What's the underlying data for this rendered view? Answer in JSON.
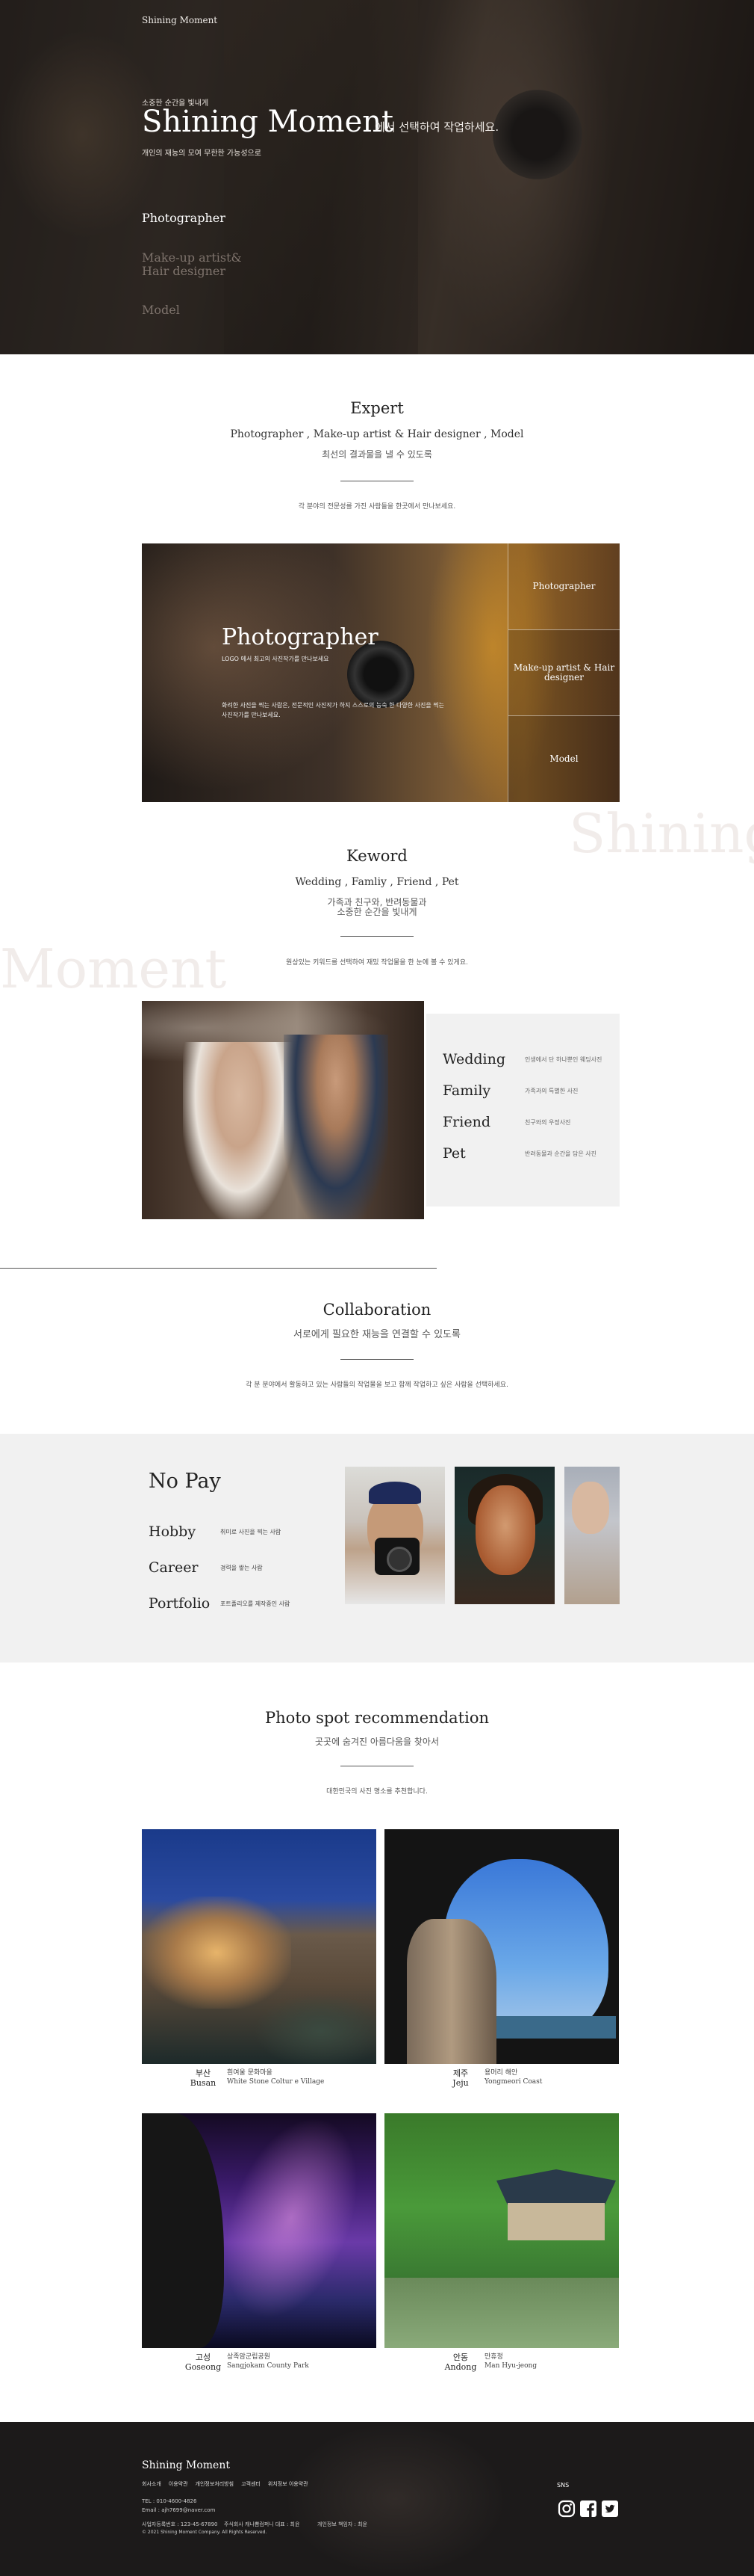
{
  "hero": {
    "brand": "Shining Moment",
    "small_caption": "소중한 순간을 빛내게",
    "title": "Shining Moment",
    "title_suffix": "에서 선택하여 작업하세요.",
    "subtitle": "개인의 재능의 모여 무한한 가능성으로",
    "menu": [
      "Photographer",
      "Make-up artist& Hair designer",
      "Model"
    ]
  },
  "expert": {
    "title": "Expert",
    "subtitle": "Photographer , Make-up artist & Hair designer , Model",
    "subtitle2": "최선의 결과물을 낼 수 있도록",
    "desc": "각 분야의 전문성를 가진 사람들을 한곳에서 만나보세요.",
    "panel_title": "Photographer",
    "panel_small": "LOGO 에서 최고의 사진작가를 만나보세요",
    "panel_desc": "화려한 사진을 찍는 사람은, 전문적인 사진작가 하지 스스로의 능숙 한 다양한 사진을 찍는 사진작가를 만나보세요.",
    "side_items": [
      "Photographer",
      "Make-up artist & Hair designer",
      "Model"
    ]
  },
  "watermarks": {
    "right": "Shining",
    "left": "Moment"
  },
  "keyword": {
    "title": "Keword",
    "subtitle": "Wedding , Famliy , Friend , Pet",
    "subtitle2_line1": "가족과 친구와, 반려동물과",
    "subtitle2_line2": "소중한 순간을 빛내게",
    "desc": "원상있는 키워드를 선택하여 재밌 작업물을 한 눈에 볼 수 있게요.",
    "items": [
      {
        "word": "Wedding",
        "desc": "인생에서 단 하나뿐인 웨딩사진"
      },
      {
        "word": "Family",
        "desc": "가족과의 특별한 사진"
      },
      {
        "word": "Friend",
        "desc": "친구와의 우정사진"
      },
      {
        "word": "Pet",
        "desc": "반려동물과 순간을 담은 사진"
      }
    ]
  },
  "collaboration": {
    "title": "Collaboration",
    "subtitle": "서로에게 필요한 재능을 연결할 수 있도록",
    "desc": "각 분 분야에서 활동하고 있는 사람들의 작업물을 보고 함께 작업하고 싶은 사람을 선택하세요."
  },
  "nopay": {
    "title": "No Pay",
    "items": [
      {
        "word": "Hobby",
        "desc": "취미로 사진을 찍는 사람"
      },
      {
        "word": "Career",
        "desc": "경력을 쌓는 사람"
      },
      {
        "word": "Portfolio",
        "desc": "포트폴리오를 제작중인 사람"
      }
    ]
  },
  "spots": {
    "title": "Photo spot recommendation",
    "subtitle": "곳곳에 숨겨진 아름다움을 찾아서",
    "desc": "대한민국의 사진 명소를 추천합니다.",
    "items": [
      {
        "name_ko": "부산",
        "name_en": "Busan",
        "desc_ko": "흰여울 문화마을",
        "desc_en": "White Stone Coltur e Village"
      },
      {
        "name_ko": "제주",
        "name_en": "Jeju",
        "desc_ko": "용머리 해안",
        "desc_en": "Yongmeori Coast"
      },
      {
        "name_ko": "고성",
        "name_en": "Goseong",
        "desc_ko": "상족암군립공원",
        "desc_en": "Sangjokam County Park"
      },
      {
        "name_ko": "안동",
        "name_en": "Andong",
        "desc_ko": "만휴정",
        "desc_en": "Man Hyu-jeong"
      }
    ]
  },
  "footer": {
    "brand": "Shining Moment",
    "links": [
      "회사소개",
      "이용약관",
      "개인정보처리방침",
      "고객센터",
      "위치정보 이용약관"
    ],
    "tel": "TEL : 010-4600-4826",
    "email": "Email : ajh7699@naver.com",
    "biz1": "사업자등록번호 : 123-45-67890",
    "biz2": "주식회사 캐나쁨컴퍼니 대표 : 최윤",
    "biz3": "개인정보 책임자 : 최윤",
    "copyright": "© 2021 Shining Moment Company. All Rights Reserved.",
    "sns_label": "SNS",
    "icons": [
      "instagram-icon",
      "facebook-icon",
      "twitter-icon"
    ]
  }
}
